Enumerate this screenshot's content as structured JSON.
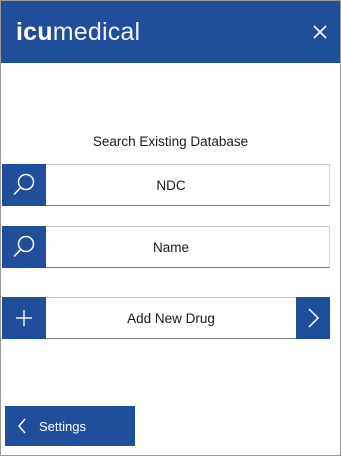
{
  "header": {
    "logo_bold": "icu",
    "logo_light": "medical",
    "close_glyph": "×"
  },
  "search": {
    "title": "Search Existing Database",
    "rows": [
      {
        "label": "NDC",
        "icon": "search-icon"
      },
      {
        "label": "Name",
        "icon": "search-icon"
      }
    ]
  },
  "add": {
    "label": "Add New Drug",
    "icon": "plus-icon",
    "arrow_icon": "chevron-right-icon"
  },
  "footer": {
    "settings_label": "Settings",
    "settings_icon": "chevron-left-icon"
  },
  "colors": {
    "brand_blue": "#1f4e9a",
    "text": "#1a1a1a"
  }
}
